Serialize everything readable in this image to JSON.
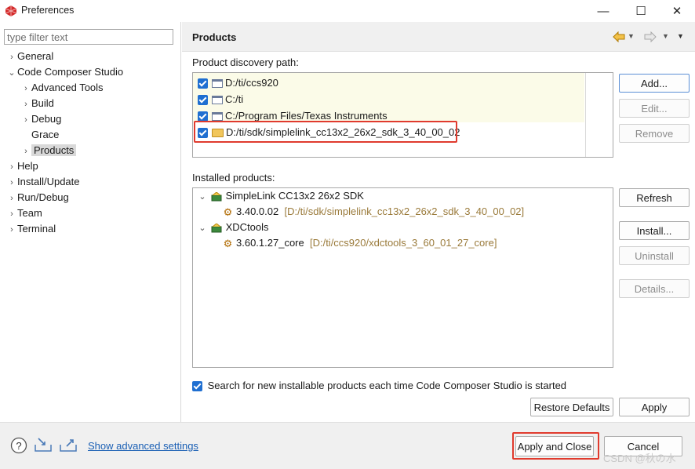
{
  "window": {
    "title": "Preferences",
    "minimize_glyph": "—",
    "maximize_glyph": "☐",
    "close_glyph": "✕"
  },
  "filter": {
    "placeholder": "type filter text",
    "value": ""
  },
  "tree": {
    "general": "General",
    "ccs": "Code Composer Studio",
    "advanced_tools": "Advanced Tools",
    "build": "Build",
    "debug": "Debug",
    "grace": "Grace",
    "products": "Products",
    "help": "Help",
    "install_update": "Install/Update",
    "run_debug": "Run/Debug",
    "team": "Team",
    "terminal": "Terminal"
  },
  "page": {
    "title": "Products"
  },
  "discovery": {
    "label": "Product discovery path:",
    "paths": [
      "D:/ti/ccs920",
      "C:/ti",
      "C:/Program Files/Texas Instruments",
      "D:/ti/sdk/simplelink_cc13x2_26x2_sdk_3_40_00_02"
    ],
    "buttons": {
      "add": "Add...",
      "edit": "Edit...",
      "remove": "Remove"
    }
  },
  "installed": {
    "label": "Installed products:",
    "products": [
      {
        "name": "SimpleLink CC13x2 26x2 SDK",
        "version": "3.40.0.02",
        "path": "[D:/ti/sdk/simplelink_cc13x2_26x2_sdk_3_40_00_02]"
      },
      {
        "name": "XDCtools",
        "version": "3.60.1.27_core",
        "path": "[D:/ti/ccs920/xdctools_3_60_01_27_core]"
      }
    ],
    "buttons": {
      "refresh": "Refresh",
      "install": "Install...",
      "uninstall": "Uninstall",
      "details": "Details..."
    }
  },
  "search_option": {
    "label": "Search for new installable products each time Code Composer Studio is started",
    "checked": true
  },
  "page_buttons": {
    "restore_defaults": "Restore Defaults",
    "apply": "Apply"
  },
  "footer": {
    "advanced_link": "Show advanced settings",
    "apply_close": "Apply and Close",
    "cancel": "Cancel"
  },
  "watermark": "CSDN @秋の水",
  "colors": {
    "highlight_red": "#e03b2e",
    "checkbox_blue": "#1f6fd1",
    "link_blue": "#1a5fb4"
  }
}
